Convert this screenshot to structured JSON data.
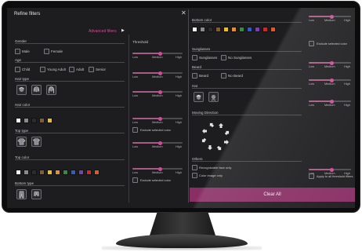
{
  "panel": {
    "title": "Refine filters",
    "advanced_label": "Advanced filters",
    "close_glyph": "✕",
    "arrow_glyph": "▶"
  },
  "gender": {
    "label": "Gender",
    "options": [
      "Male",
      "Female"
    ]
  },
  "age": {
    "label": "Age",
    "options": [
      "Child",
      "Young Adult",
      "Adult",
      "Senior"
    ]
  },
  "hair_type": {
    "label": "Hair type"
  },
  "hair_color": {
    "label": "Hair color",
    "swatches": [
      "#f2f2f2",
      "#8a8a8a",
      "#2b2b2b",
      "#8a5a2e",
      "#f0c010"
    ]
  },
  "top_type": {
    "label": "Top type"
  },
  "top_color": {
    "label": "Top color",
    "swatches": [
      "#f2f2f2",
      "#8a8a8a",
      "#2b2b2b",
      "#8a5a2e",
      "#f0c010",
      "#f08c1c",
      "#2f8f3c",
      "#2f5bd1",
      "#7a3fb0",
      "#d8232a",
      "#e05a1c"
    ]
  },
  "bottom_type": {
    "label": "Bottom type"
  },
  "bottom_color": {
    "label": "Bottom color",
    "swatches": [
      "#f2f2f2",
      "#8a8a8a",
      "#2b2b2b",
      "#8a5a2e",
      "#f0c010",
      "#f08c1c",
      "#2f8f3c",
      "#2f5bd1",
      "#7a3fb0",
      "#d8232a",
      "#e05a1c"
    ]
  },
  "sunglasses": {
    "label": "Sunglasses",
    "options": [
      "Sunglasses",
      "No Sunglasses"
    ]
  },
  "beard": {
    "label": "Beard",
    "options": [
      "Beard",
      "No Beard"
    ]
  },
  "hat": {
    "label": "Hat"
  },
  "moving_direction": {
    "label": "Moving Direction"
  },
  "others": {
    "label": "Others",
    "options": [
      "Recognizable face only",
      "Color image only"
    ]
  },
  "threshold": {
    "label": "Threshold",
    "low": "Low",
    "medium": "Medium",
    "high": "High",
    "exclude_selected_color": "Exclude selected color",
    "apply_all": "Apply to all threshold filters"
  },
  "clear_all": "Clear All",
  "colors": {
    "accent": "#d24b97",
    "button": "#8a2f66"
  }
}
